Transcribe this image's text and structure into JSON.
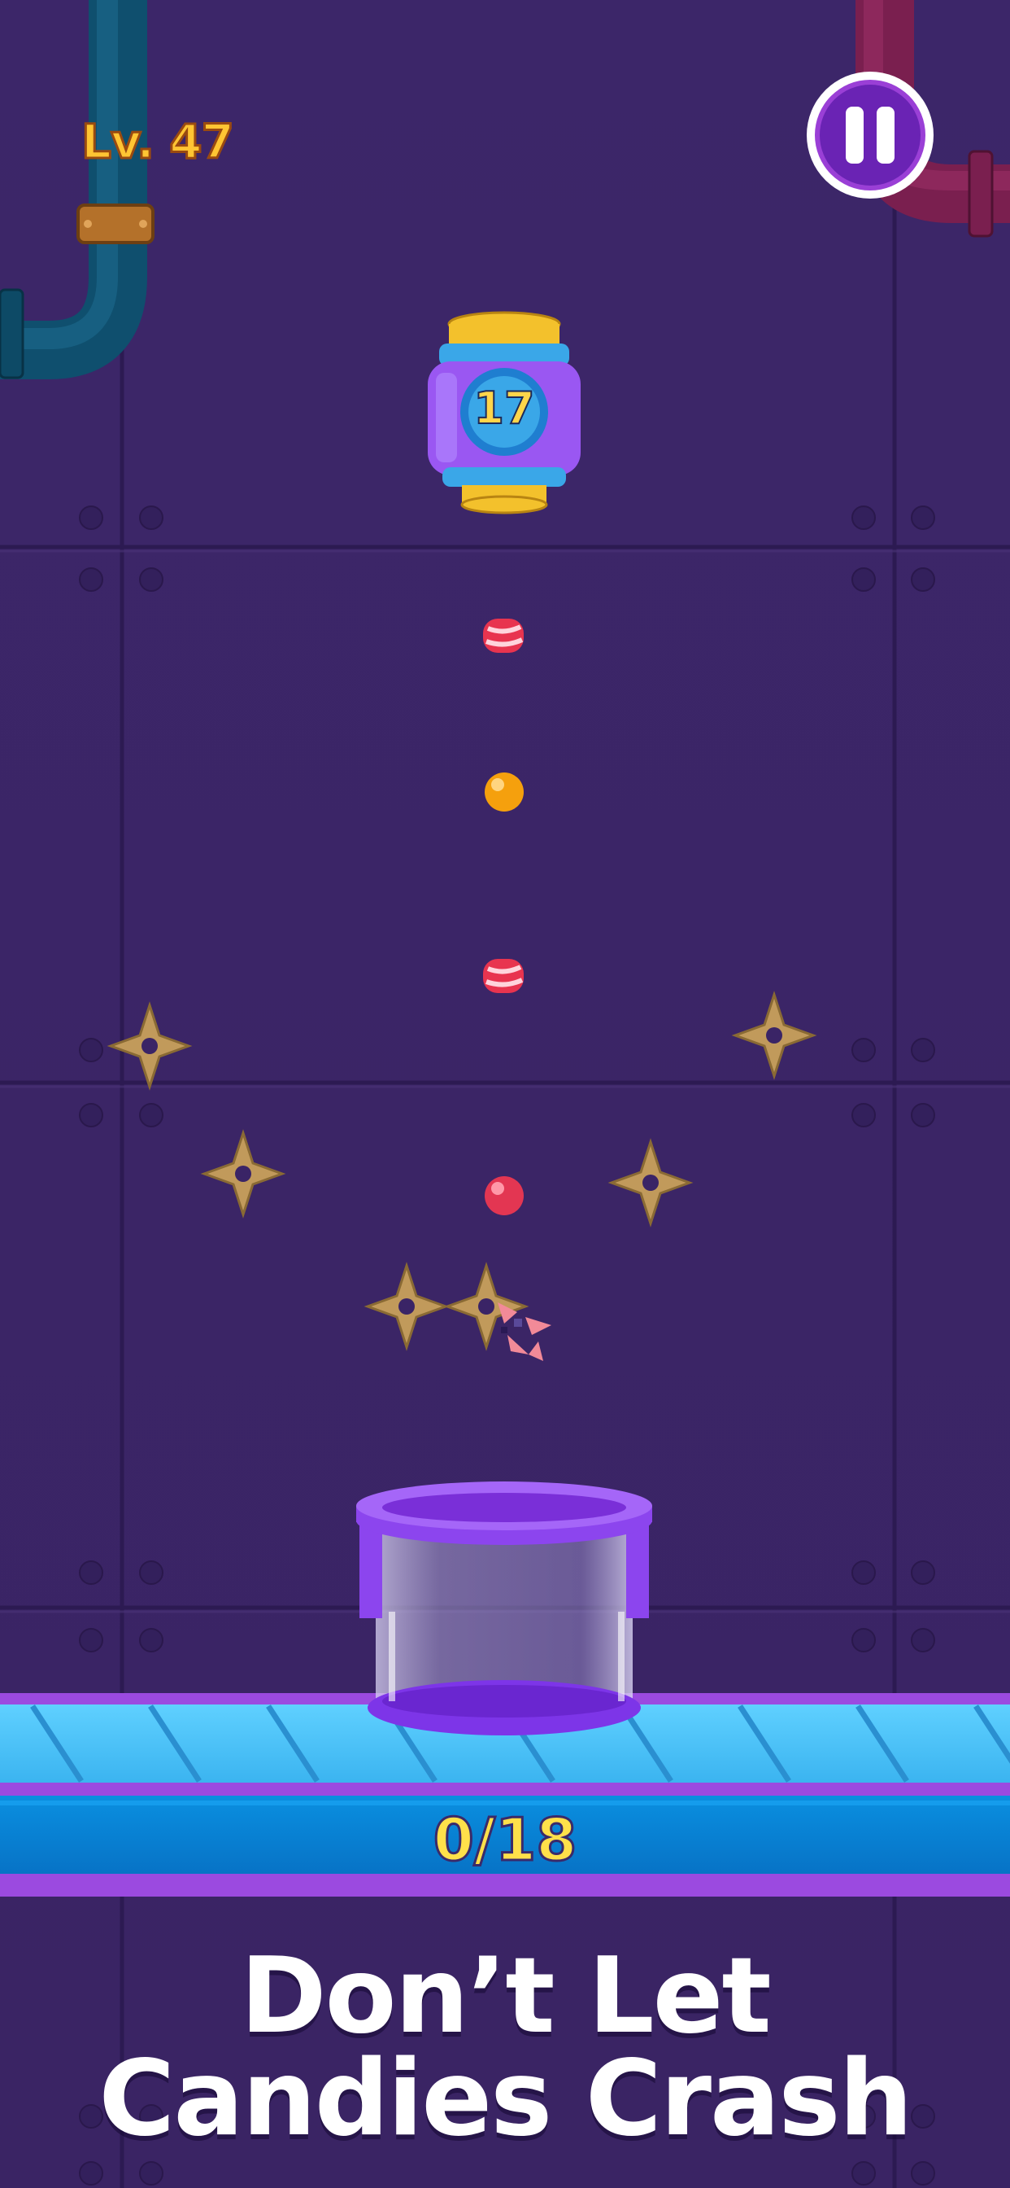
{
  "hud": {
    "level_label": "Lv. 47",
    "pause_icon": "pause-icon"
  },
  "dispenser": {
    "remaining": "17"
  },
  "progress": {
    "counter": "0/18"
  },
  "caption": {
    "line1": "Don’t Let",
    "line2": "Candies Crash"
  },
  "colors": {
    "background": "#3a2466",
    "level_text": "#ffc533",
    "counter_text": "#ffe04a",
    "conveyor": "#4fc3f7",
    "jar": "#8a3df0",
    "star_obstacle": "#c19a5b"
  },
  "candies": [
    {
      "kind": "striped-red-candy"
    },
    {
      "kind": "orange-round-candy"
    },
    {
      "kind": "striped-red-candy"
    },
    {
      "kind": "red-round-candy"
    },
    {
      "kind": "crashed-candy-fragments"
    }
  ]
}
